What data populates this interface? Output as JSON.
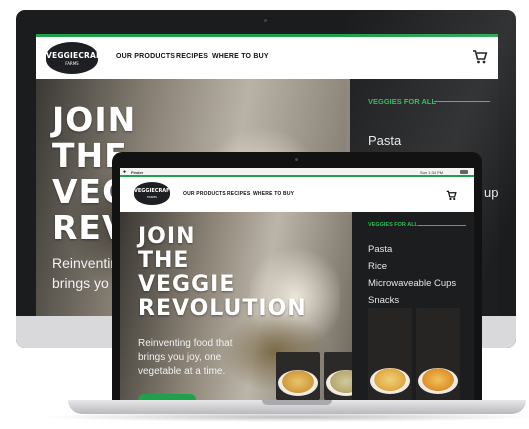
{
  "brand": {
    "logo_text": "VEGGIECRAFT",
    "logo_sub": "FARMS"
  },
  "nav": {
    "items": [
      {
        "label": "OUR PRODUCTS"
      },
      {
        "label": "RECIPES"
      },
      {
        "label": "WHERE TO BUY"
      }
    ],
    "cart_icon": "cart-icon"
  },
  "hero": {
    "title_lines": [
      "JOIN",
      "THE",
      "VEGGIE",
      "REVOLUTION"
    ],
    "desktop_title_lines": [
      "JOIN",
      "THE",
      "VEGGIE",
      "REV"
    ],
    "subtitle_lines": [
      "Reinventing food that",
      "brings you joy, one",
      "vegetable at a time."
    ],
    "desktop_subtitle_lines": [
      "Reinventing",
      "brings yo"
    ]
  },
  "sidebar": {
    "heading": "VEGGIES FOR ALL",
    "items": [
      {
        "label": "Pasta"
      },
      {
        "label": "Rice"
      },
      {
        "label": "Microwaveable Cups"
      },
      {
        "label": "Snacks"
      }
    ],
    "desktop_cut_text": "ups"
  },
  "macos_menubar": {
    "app": "Finder",
    "clock": "Sun 1:34 PM"
  },
  "colors": {
    "accent_green": "#1fa04a",
    "sidebar_bg": "#1d1e1f",
    "nav_bg": "#ffffff"
  }
}
